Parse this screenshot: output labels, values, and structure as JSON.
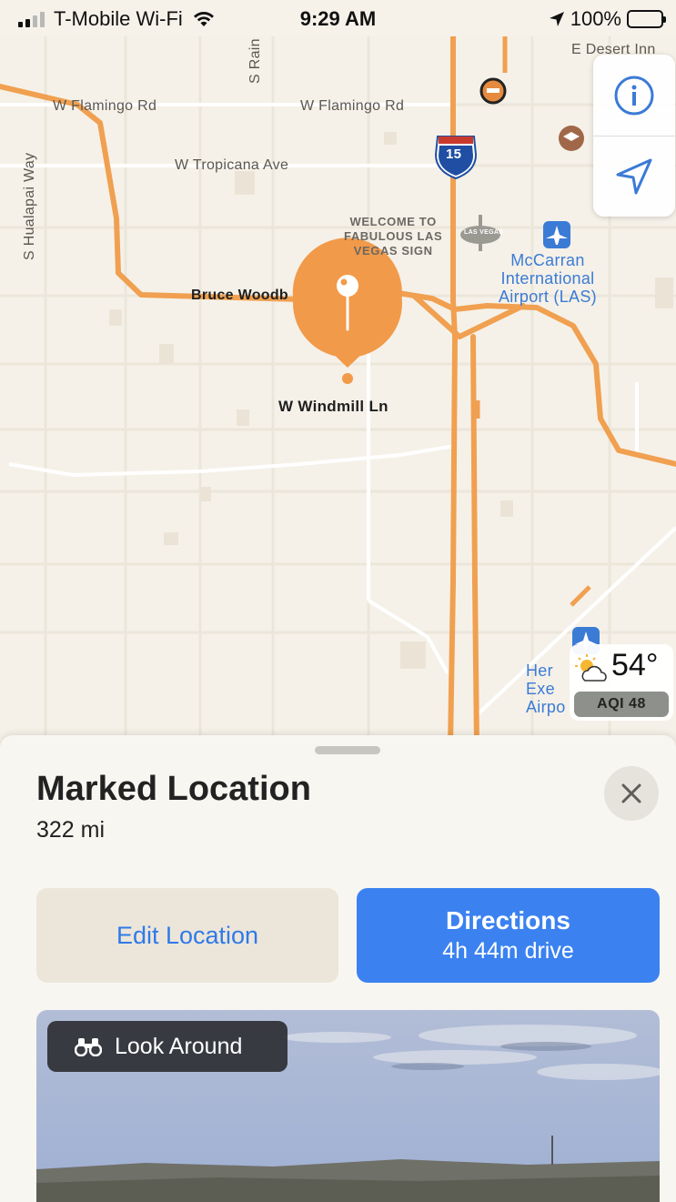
{
  "status_bar": {
    "carrier": "T-Mobile Wi-Fi",
    "time": "9:29 AM",
    "battery": "100%"
  },
  "map": {
    "labels": {
      "e_desert_inn": "E Desert Inn",
      "s_rainbow": "S Rain",
      "w_flamingo_1": "W Flamingo Rd",
      "w_flamingo_2": "W Flamingo Rd",
      "w_tropicana": "W Tropicana Ave",
      "s_hualapai": "S Hualapai Way",
      "bruce_woodbury": "Bruce Woodb",
      "welcome_sign": "WELCOME TO\nFABULOUS LAS\nVEGAS SIGN",
      "mccarran": "McCarran\nInternational\nAirport (LAS)",
      "pin_street": "W Windmill Ln",
      "henderson": "Her\nExe\nAirpo",
      "interstate": "15",
      "vegas_sign_text": "LAS VEGAS"
    },
    "controls": {
      "info": "info-icon",
      "locate": "location-arrow-icon"
    },
    "weather": {
      "temp": "54°",
      "aqi": "AQI 48"
    },
    "colors": {
      "highway": "#f0a050",
      "pin": "#f19a4a",
      "land": "#f5f1e8",
      "road": "#e9e3d7"
    }
  },
  "sheet": {
    "title": "Marked Location",
    "distance": "322 mi",
    "edit_label": "Edit Location",
    "directions_label": "Directions",
    "directions_sub": "4h 44m drive",
    "look_around_label": "Look Around"
  }
}
